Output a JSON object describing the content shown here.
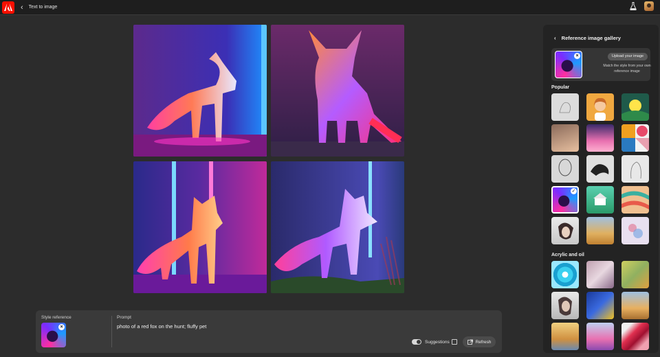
{
  "header": {
    "title": "Text to image",
    "back_icon": "chevron-left-icon",
    "logo_icon": "adobe-logo-icon",
    "labs_icon": "flask-icon",
    "avatar_icon": "user-avatar"
  },
  "results": {
    "images": [
      {
        "name": "result-image-1",
        "subject": "neon fox side view"
      },
      {
        "name": "result-image-2",
        "subject": "neon fox front view"
      },
      {
        "name": "result-image-3",
        "subject": "neon fox between light pillars"
      },
      {
        "name": "result-image-4",
        "subject": "neon fox walking"
      }
    ]
  },
  "prompt_bar": {
    "style_reference_label": "Style reference",
    "prompt_label": "Prompt",
    "prompt_text": "photo of a red fox on the hunt; fluffy pet",
    "suggestions_label": "Suggestions",
    "suggestions_on": true,
    "refresh_label": "Refresh"
  },
  "panel": {
    "title": "Reference image gallery",
    "upload_button": "Upload your image",
    "upload_description": "Match the style from your own reference image",
    "sections": [
      {
        "label": "Popular"
      },
      {
        "label": "Acrylic and oil"
      }
    ]
  },
  "colors": {
    "accent_red": "#fa0f00",
    "neon_pink": "#ff2ea0",
    "neon_blue": "#1c9bff",
    "neon_purple": "#7a2cff"
  }
}
